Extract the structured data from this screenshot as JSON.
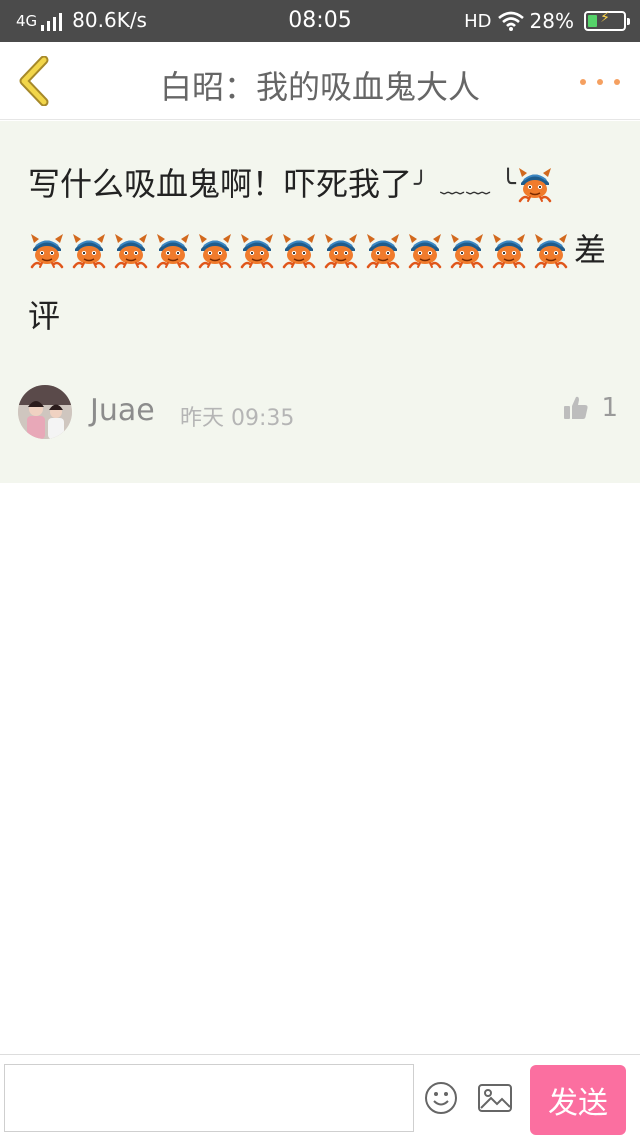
{
  "status_bar": {
    "network": "4G",
    "speed": "80.6K/s",
    "time": "08:05",
    "hd": "HD",
    "battery": "28%",
    "battery_level": 0.28
  },
  "nav": {
    "title": "白昭：我的吸血鬼大人"
  },
  "comment": {
    "line1_text": "写什么吸血鬼啊！吓死我了",
    "kaomoji_left": "╯ ﹏﹏",
    "kaomoji_right": "╰",
    "line2_text": "差",
    "line3_text": "评",
    "emoji_repeat": 13,
    "author": "Juae",
    "date_label": "昨天",
    "time": "09:35",
    "likes": "1"
  },
  "input": {
    "value": "",
    "placeholder": "",
    "send_label": "发送"
  },
  "colors": {
    "status_bg": "#4b4b4b",
    "card_bg": "#f3f6ee",
    "accent_back": "#e7c43a",
    "send_bg": "#fb6fa0",
    "more_dots": "#f5a060"
  },
  "icons": {
    "back": "back-chevron-icon",
    "more": "more-dots-icon",
    "emoji": "demon-emoji-icon",
    "like": "thumbs-up-icon",
    "smiley": "smiley-icon",
    "image": "image-icon"
  }
}
